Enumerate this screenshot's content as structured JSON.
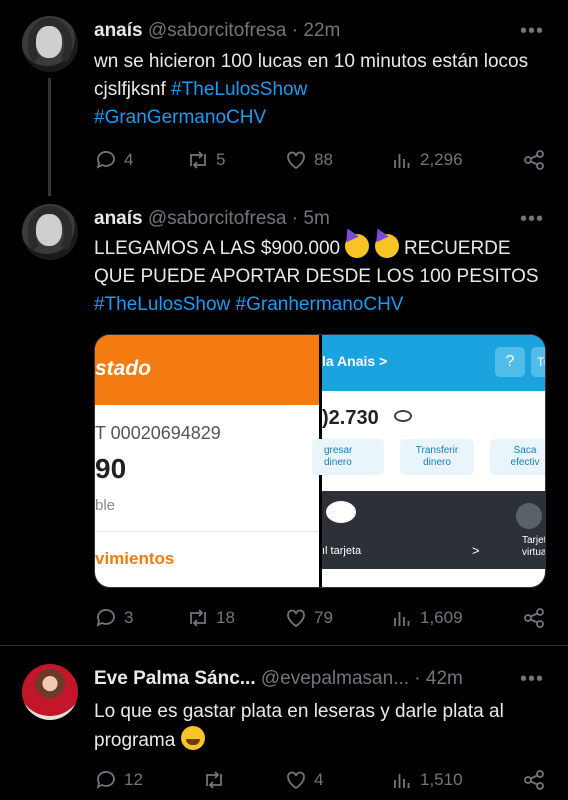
{
  "tweets": [
    {
      "name": "anaís",
      "handle": "@saborcitofresa",
      "time": "· 22m",
      "text_plain": "wn se hicieron 100 lucas en 10 minutos están locos cjslfjksnf ",
      "hashtag1": "#TheLulosShow",
      "hashtag2": "#GranGermanoCHV",
      "replies": "4",
      "retweets": "5",
      "likes": "88",
      "views": "2,296"
    },
    {
      "name": "anaís",
      "handle": "@saborcitofresa",
      "time": "· 5m",
      "text_a": "LLEGAMOS A LAS $900.000 ",
      "text_b": " RECUERDE QUE PUEDE APORTAR DESDE LOS 100 PESITOS",
      "hashtag1": "#TheLulosShow",
      "hashtag2": "#GranhermanoCHV",
      "replies": "3",
      "retweets": "18",
      "likes": "79",
      "views": "1,609",
      "media": {
        "left": {
          "brand": "stado",
          "account": "T 00020694829",
          "balance": "90",
          "balance_label": "ble",
          "movements": "vimientos",
          "color": "#f47b11"
        },
        "right": {
          "greeting": "la Anais >",
          "help": "?",
          "help2": "Tu",
          "amount": ")2.730",
          "chip1": "gresar\ndinero",
          "chip2": "Transferir\ndinero",
          "chip3": "Saca\nefectiv",
          "card": "ıl tarjeta",
          "chevron": ">",
          "card2": "Tarjet\nvirtua",
          "color": "#1ba3e0"
        }
      }
    },
    {
      "name": "Eve Palma Sánc...",
      "handle": "@evepalmasan...",
      "time": "· 42m",
      "text": "Lo que es gastar plata en leseras y darle plata al programa ",
      "replies": "12",
      "retweets": "",
      "likes": "4",
      "views": "1,510"
    }
  ],
  "more_label": "•••",
  "colors": {
    "link": "#1d9bf0",
    "muted": "#71767b",
    "background": "#000000"
  }
}
